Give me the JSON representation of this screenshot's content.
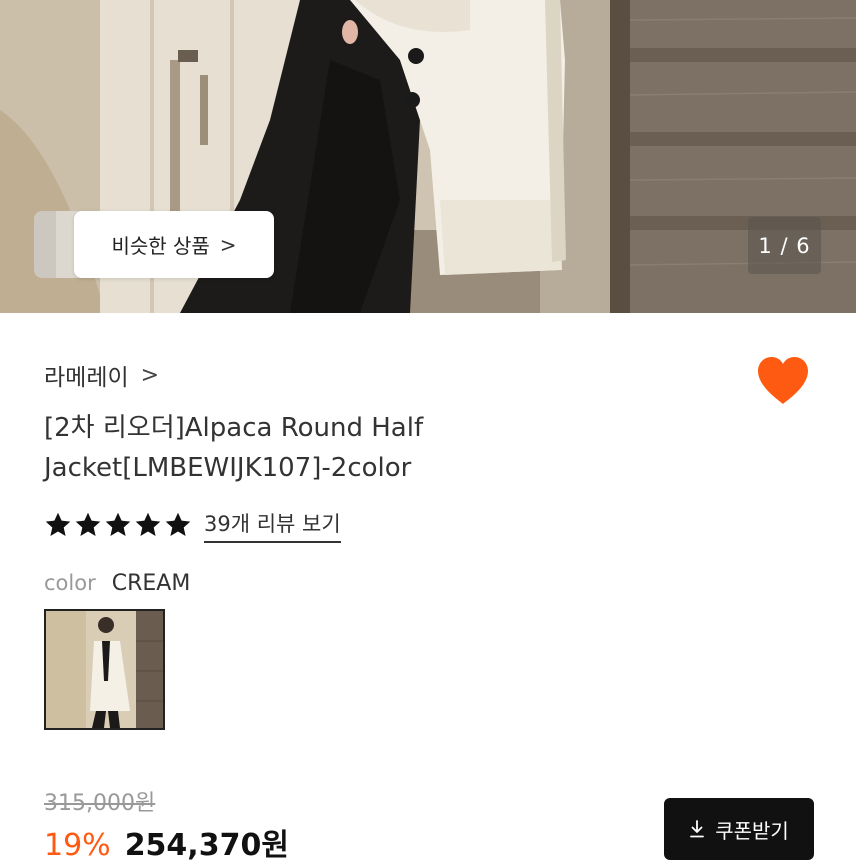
{
  "gallery": {
    "similar_label": "비슷한 상품",
    "similar_chevron": ">",
    "counter": "1 / 6"
  },
  "product": {
    "brand": "라메레이",
    "brand_chevron": ">",
    "title_line1": "[2차 리오더]Alpaca Round Half",
    "title_line2": "Jacket[LMBEWIJK107]-2color",
    "rating_stars": 5,
    "review_link": "39개 리뷰 보기",
    "color_key": "color",
    "color_value": "CREAM",
    "original_price": "315,000원",
    "discount": "19%",
    "sale_price": "254,370원",
    "coupon_label": "쿠폰받기"
  },
  "colors": {
    "heart": "#ff5a12",
    "discount": "#ff5a12",
    "coupon_bg": "#111111"
  },
  "icons": {
    "heart": "heart-icon",
    "star": "star-icon",
    "download": "download-icon",
    "chevron": "chevron-right-icon"
  }
}
